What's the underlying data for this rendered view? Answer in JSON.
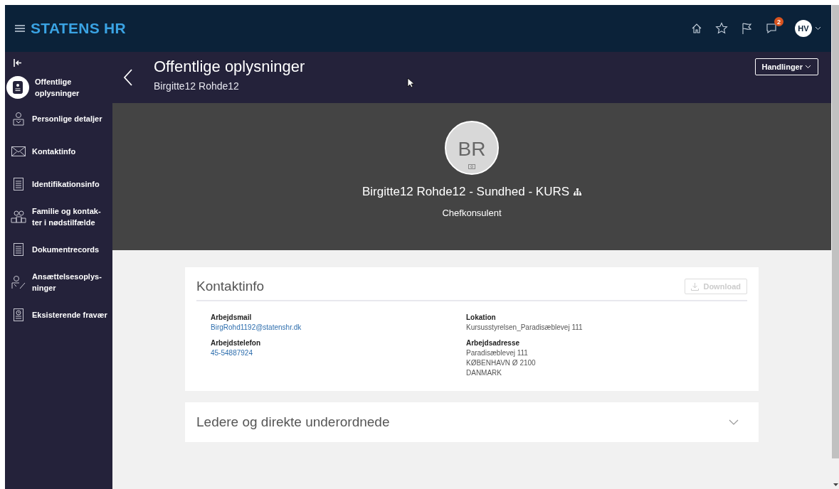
{
  "header": {
    "brand": "STATENS HR",
    "notification_count": "2",
    "avatar_initials": "HV"
  },
  "sidebar": {
    "items": [
      {
        "label": "Offentlige oplysninger",
        "kind": "badge",
        "selected": true
      },
      {
        "label": "Personlige detaljer",
        "kind": "person",
        "selected": false
      },
      {
        "label": "Kontaktinfo",
        "kind": "mail",
        "selected": false
      },
      {
        "label": "Identifikationsinfo",
        "kind": "doc",
        "selected": false
      },
      {
        "label": "Familie og kontak-ter i nødstilfælde",
        "kind": "group",
        "selected": false
      },
      {
        "label": "Dokumentrecords",
        "kind": "doc",
        "selected": false
      },
      {
        "label": "Ansættelsesoplys-ninger",
        "kind": "edit",
        "selected": false
      },
      {
        "label": "Eksisterende fravær",
        "kind": "clock",
        "selected": false
      }
    ]
  },
  "page": {
    "title": "Offentlige oplysninger",
    "subtitle": "Birgitte12 Rohde12",
    "actions_button": "Handlinger"
  },
  "profile": {
    "initials": "BR",
    "name": "Birgitte12 Rohde12 - Sundhed - KURS",
    "job_title": "Chefkonsulent"
  },
  "contact_card": {
    "title": "Kontaktinfo",
    "download_button": "Download",
    "download_disabled": true,
    "left": [
      {
        "label": "Arbejdsmail",
        "values": [
          "BirgRohd1192@statenshr.dk"
        ],
        "kind": "link"
      },
      {
        "label": "Arbejdstelefon",
        "values": [
          "45-54887924"
        ],
        "kind": "link"
      }
    ],
    "right": [
      {
        "label": "Lokation",
        "values": [
          "Kursusstyrelsen_Paradisæblevej 111"
        ],
        "kind": "text"
      },
      {
        "label": "Arbejdsadresse",
        "values": [
          "Paradisæblevej 111",
          "KØBENHAVN Ø 2100",
          "DANMARK"
        ],
        "kind": "text"
      }
    ]
  },
  "managers_card": {
    "title": "Ledere og direkte underordnede",
    "expanded": false
  }
}
